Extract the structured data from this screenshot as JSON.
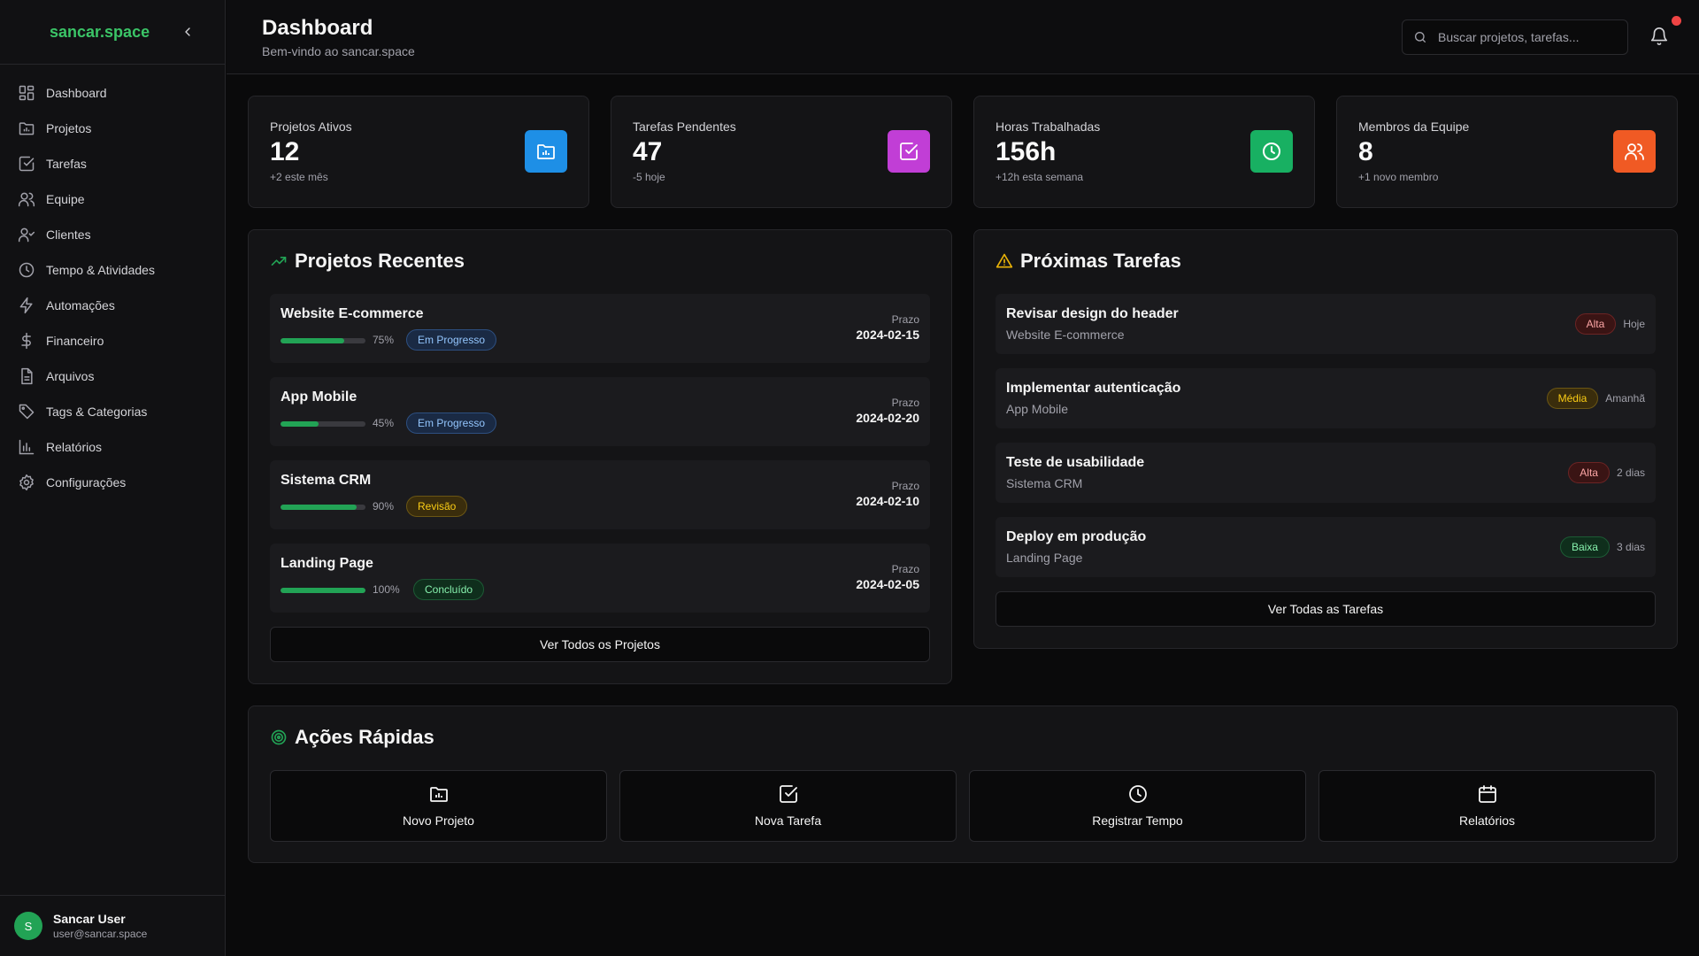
{
  "brand": "sancar.space",
  "nav": [
    {
      "label": "Dashboard",
      "icon": "dashboard-icon"
    },
    {
      "label": "Projetos",
      "icon": "folder-icon"
    },
    {
      "label": "Tarefas",
      "icon": "checkbox-icon"
    },
    {
      "label": "Equipe",
      "icon": "users-icon"
    },
    {
      "label": "Clientes",
      "icon": "user-check-icon"
    },
    {
      "label": "Tempo & Atividades",
      "icon": "clock-icon"
    },
    {
      "label": "Automações",
      "icon": "zap-icon"
    },
    {
      "label": "Financeiro",
      "icon": "dollar-icon"
    },
    {
      "label": "Arquivos",
      "icon": "file-icon"
    },
    {
      "label": "Tags & Categorias",
      "icon": "tag-icon"
    },
    {
      "label": "Relatórios",
      "icon": "bar-chart-icon"
    },
    {
      "label": "Configurações",
      "icon": "gear-icon"
    }
  ],
  "user": {
    "initial": "S",
    "name": "Sancar User",
    "email": "user@sancar.space"
  },
  "header": {
    "title": "Dashboard",
    "subtitle": "Bem-vindo ao sancar.space",
    "search_placeholder": "Buscar projetos, tarefas..."
  },
  "stats": [
    {
      "label": "Projetos Ativos",
      "value": "12",
      "sub": "+2 este mês",
      "icon": "folder-icon",
      "color": "#1e8fe6"
    },
    {
      "label": "Tarefas Pendentes",
      "value": "47",
      "sub": "-5 hoje",
      "icon": "checkbox-icon",
      "color": "#c13ed6"
    },
    {
      "label": "Horas Trabalhadas",
      "value": "156h",
      "sub": "+12h esta semana",
      "icon": "clock-icon",
      "color": "#18b062"
    },
    {
      "label": "Membros da Equipe",
      "value": "8",
      "sub": "+1 novo membro",
      "icon": "users-icon",
      "color": "#f05a24"
    }
  ],
  "recent_projects": {
    "title": "Projetos Recentes",
    "deadline_label": "Prazo",
    "items": [
      {
        "name": "Website E-commerce",
        "progress": 75,
        "progress_label": "75%",
        "status": "Em Progresso",
        "deadline": "2024-02-15"
      },
      {
        "name": "App Mobile",
        "progress": 45,
        "progress_label": "45%",
        "status": "Em Progresso",
        "deadline": "2024-02-20"
      },
      {
        "name": "Sistema CRM",
        "progress": 90,
        "progress_label": "90%",
        "status": "Revisão",
        "deadline": "2024-02-10"
      },
      {
        "name": "Landing Page",
        "progress": 100,
        "progress_label": "100%",
        "status": "Concluído",
        "deadline": "2024-02-05"
      }
    ],
    "view_all": "Ver Todos os Projetos"
  },
  "upcoming_tasks": {
    "title": "Próximas Tarefas",
    "items": [
      {
        "name": "Revisar design do header",
        "project": "Website E-commerce",
        "priority": "Alta",
        "due": "Hoje"
      },
      {
        "name": "Implementar autenticação",
        "project": "App Mobile",
        "priority": "Média",
        "due": "Amanhã"
      },
      {
        "name": "Teste de usabilidade",
        "project": "Sistema CRM",
        "priority": "Alta",
        "due": "2 dias"
      },
      {
        "name": "Deploy em produção",
        "project": "Landing Page",
        "priority": "Baixa",
        "due": "3 dias"
      }
    ],
    "view_all": "Ver Todas as Tarefas"
  },
  "quick_actions": {
    "title": "Ações Rápidas",
    "items": [
      {
        "label": "Novo Projeto",
        "icon": "folder-icon"
      },
      {
        "label": "Nova Tarefa",
        "icon": "checkbox-icon"
      },
      {
        "label": "Registrar Tempo",
        "icon": "clock-icon"
      },
      {
        "label": "Relatórios",
        "icon": "calendar-icon"
      }
    ]
  },
  "colors": {
    "brand": "#3bc567",
    "progress": "#22a355",
    "notification": "#ef4444",
    "warning": "#eab308"
  }
}
